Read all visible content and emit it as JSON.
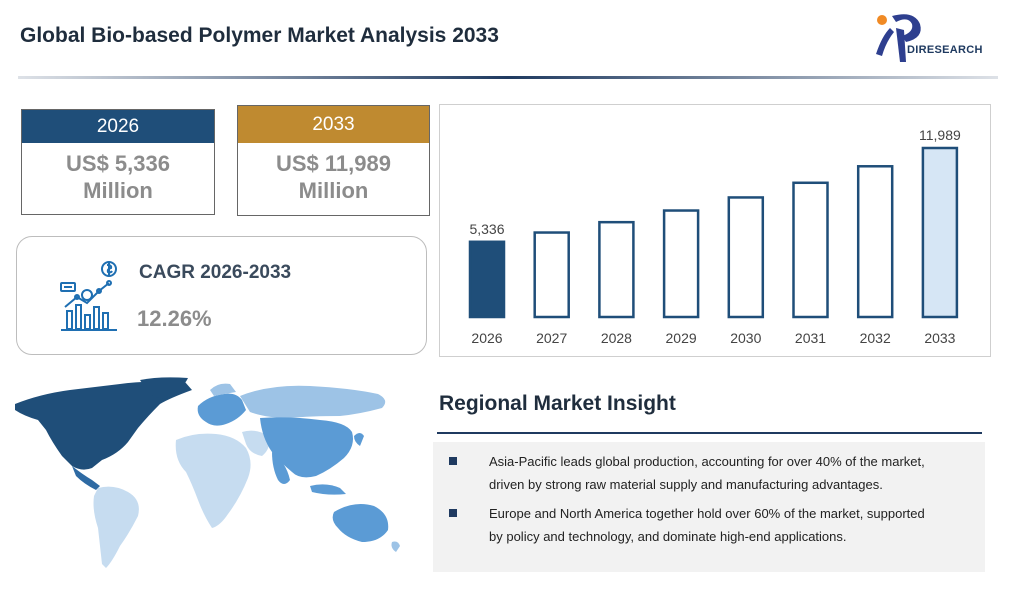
{
  "header": {
    "title": "Global Bio-based Polymer Market Analysis 2033",
    "logo_text": "DIRESEARCH"
  },
  "stats": [
    {
      "year": "2026",
      "value": "US$ 5,336",
      "unit": "Million",
      "color": "#1f4e79"
    },
    {
      "year": "2033",
      "value": "US$ 11,989",
      "unit": "Million",
      "color": "#bf8a30"
    }
  ],
  "cagr": {
    "title": "CAGR 2026-2033",
    "value": "12.26%",
    "icon": "analytics-icon"
  },
  "chart_data": {
    "type": "bar",
    "categories": [
      "2026",
      "2027",
      "2028",
      "2029",
      "2030",
      "2031",
      "2032",
      "2033"
    ],
    "values": [
      5336,
      5992,
      6727,
      7553,
      8481,
      9522,
      10692,
      11989
    ],
    "data_labels": {
      "2026": "5,336",
      "2033": "11,989"
    },
    "colors": {
      "first": "#1f4e79",
      "middle": "#ffffff",
      "last": "#d6e6f5",
      "stroke": "#1f4e79"
    },
    "grid": false,
    "title": "",
    "xlabel": "",
    "ylabel": ""
  },
  "map": {
    "icon": "world-map-icon",
    "colors": {
      "dark": "#1f4e79",
      "mid": "#5b9bd5",
      "light": "#9dc3e6",
      "pale": "#c6dcf0"
    }
  },
  "insight": {
    "title": "Regional Market Insight",
    "bullets": [
      {
        "lines": [
          "Asia-Pacific leads global production, accounting for over 40% of the market,",
          "driven by strong raw material supply and manufacturing advantages."
        ]
      },
      {
        "lines": [
          "Europe and North America together hold over 60% of the market, supported",
          "by policy and technology, and dominate high-end applications."
        ]
      }
    ]
  }
}
